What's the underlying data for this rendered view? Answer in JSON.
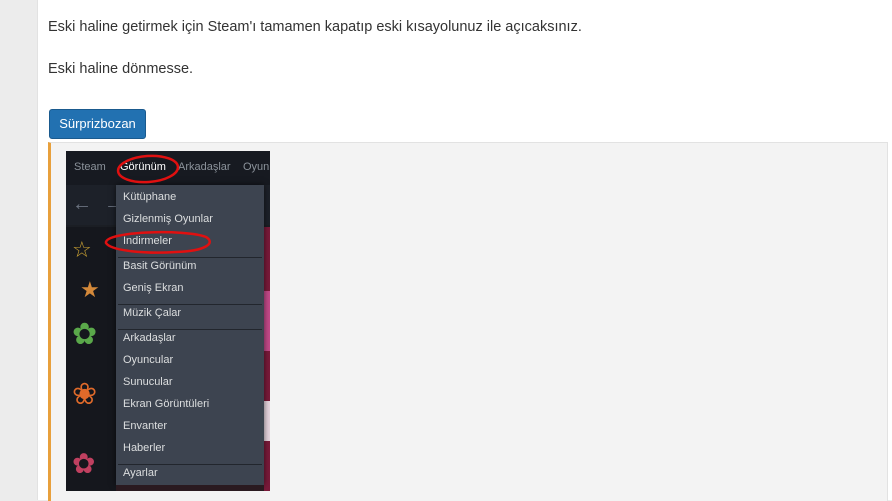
{
  "post": {
    "paragraph1": "Eski haline getirmek için Steam'ı tamamen kapatıp eski kısayolunuz ile açıcaksınız.",
    "paragraph2": "Eski haline dönmesse.",
    "spoiler_button": "Sürprizbozan"
  },
  "screenshot": {
    "menubar": [
      "Steam",
      "Görünüm",
      "Arkadaşlar",
      "Oyun"
    ],
    "dropdown": {
      "group1": [
        "Kütüphane",
        "Gizlenmiş Oyunlar",
        "İndirmeler"
      ],
      "group2": [
        "Basit Görünüm",
        "Geniş Ekran"
      ],
      "group3": [
        "Müzik Çalar"
      ],
      "group4": [
        "Arkadaşlar",
        "Oyuncular",
        "Sunucular",
        "Ekran Görüntüleri",
        "Envanter",
        "Haberler"
      ],
      "group5": [
        "Ayarlar"
      ]
    },
    "colors": {
      "accent": "#2271b1",
      "spoiler_border": "#e8a03c",
      "annotation_red": "#e01010"
    }
  }
}
